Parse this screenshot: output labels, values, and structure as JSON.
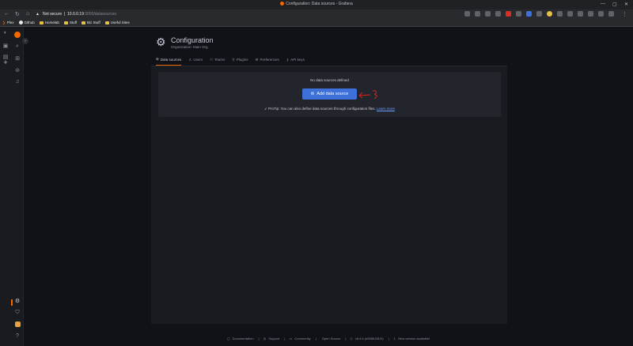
{
  "browser": {
    "window_title": "Configuration: Data sources - Grafana",
    "security_label": "Not secure",
    "host": "10.0.0.19",
    "path": ":3000/datasources",
    "minimize_glyph": "—",
    "maximize_glyph": "▢",
    "close_glyph": "✕"
  },
  "bookmarks": [
    {
      "label": "Plex",
      "icon": "play-icon"
    },
    {
      "label": "Github",
      "icon": "github-icon"
    },
    {
      "label": "Homelab",
      "icon": "folder-icon"
    },
    {
      "label": "Stuff",
      "icon": "folder-icon"
    },
    {
      "label": "Biz Stuff",
      "icon": "folder-icon"
    },
    {
      "label": "Useful Sites",
      "icon": "folder-icon"
    }
  ],
  "page": {
    "title": "Configuration",
    "subtitle": "Organization: Main Org."
  },
  "tabs": [
    {
      "label": "Data sources",
      "glyph": "⊜",
      "active": true
    },
    {
      "label": "Users",
      "glyph": "♙",
      "active": false
    },
    {
      "label": "Teams",
      "glyph": "⚇",
      "active": false
    },
    {
      "label": "Plugins",
      "glyph": "⚲",
      "active": false
    },
    {
      "label": "Preferences",
      "glyph": "⚙",
      "active": false
    },
    {
      "label": "API keys",
      "glyph": "⚷",
      "active": false
    }
  ],
  "empty_state": {
    "message": "No data sources defined",
    "button_label": "Add data source",
    "protip_text": "ProTip: You can also define data sources through configuration files.",
    "learn_more": "Learn more"
  },
  "footer": {
    "items": [
      "Documentation",
      "Support",
      "Community",
      "Open Source",
      "v8.4.6 (d9586181f1)",
      "New version available!"
    ],
    "separator": "|"
  },
  "colors": {
    "accent": "#f46800",
    "primary_button": "#3d71d9",
    "annotation_arrow": "#e0201c"
  }
}
